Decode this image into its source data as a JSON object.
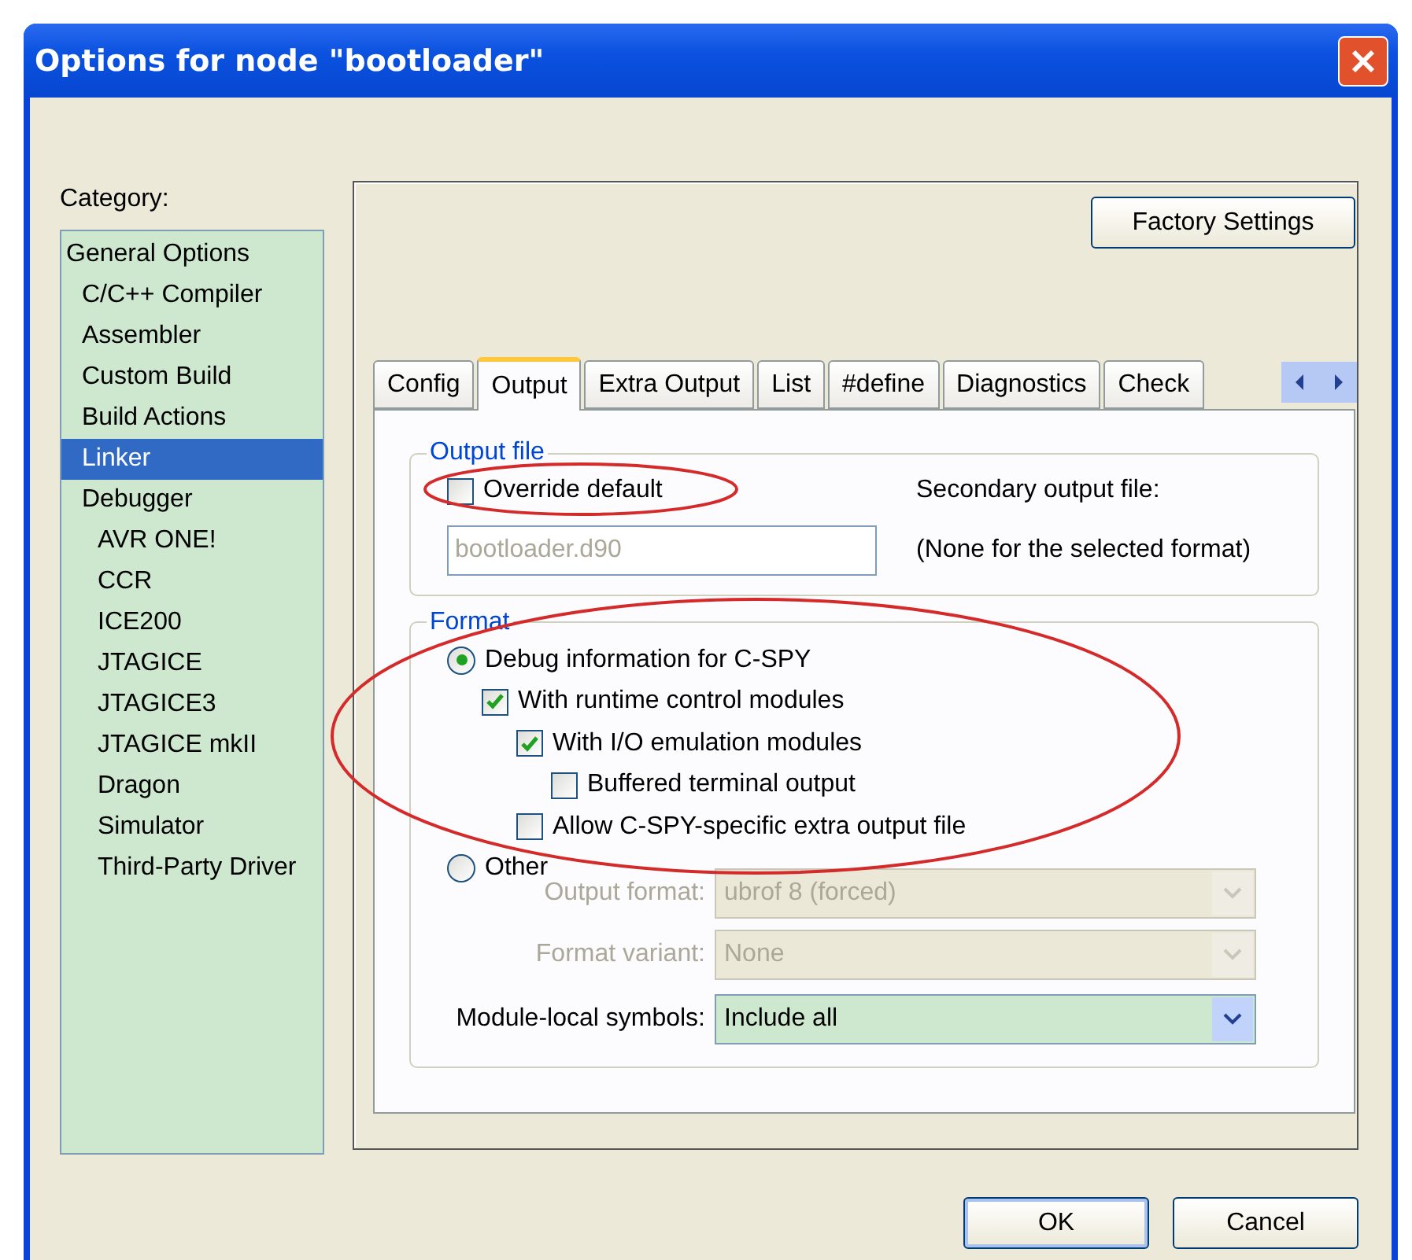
{
  "window": {
    "title": "Options for node \"bootloader\""
  },
  "category": {
    "label": "Category:",
    "items": [
      {
        "label": "General Options",
        "selected": false,
        "children": [
          {
            "label": "C/C++ Compiler",
            "selected": false
          },
          {
            "label": "Assembler",
            "selected": false
          },
          {
            "label": "Custom Build",
            "selected": false
          },
          {
            "label": "Build Actions",
            "selected": false
          },
          {
            "label": "Linker",
            "selected": true
          },
          {
            "label": "Debugger",
            "selected": false,
            "children": [
              {
                "label": "AVR ONE!",
                "selected": false
              },
              {
                "label": "CCR",
                "selected": false
              },
              {
                "label": "ICE200",
                "selected": false
              },
              {
                "label": "JTAGICE",
                "selected": false
              },
              {
                "label": "JTAGICE3",
                "selected": false
              },
              {
                "label": "JTAGICE mkII",
                "selected": false
              },
              {
                "label": "Dragon",
                "selected": false
              },
              {
                "label": "Simulator",
                "selected": false
              },
              {
                "label": "Third-Party Driver",
                "selected": false
              }
            ]
          }
        ]
      }
    ]
  },
  "factory_button": "Factory Settings",
  "tabs": [
    {
      "label": "Config",
      "selected": false
    },
    {
      "label": "Output",
      "selected": true
    },
    {
      "label": "Extra Output",
      "selected": false
    },
    {
      "label": "List",
      "selected": false
    },
    {
      "label": "#define",
      "selected": false
    },
    {
      "label": "Diagnostics",
      "selected": false
    },
    {
      "label": "Check",
      "selected": false
    }
  ],
  "output_file": {
    "legend": "Output file",
    "override": {
      "label": "Override default",
      "checked": false
    },
    "file": {
      "value": "bootloader.d90",
      "disabled": true
    },
    "secondary_label": "Secondary output file:",
    "secondary_value": "(None for the selected format)"
  },
  "format": {
    "legend": "Format",
    "options": [
      {
        "kind": "radio",
        "label": "Debug information for C-SPY",
        "selected": true,
        "children": [
          {
            "kind": "checkbox",
            "label": "With runtime control modules",
            "checked": true,
            "children": [
              {
                "kind": "checkbox",
                "label": "With I/O emulation modules",
                "checked": true,
                "children": [
                  {
                    "kind": "checkbox",
                    "label": "Buffered terminal output",
                    "checked": false
                  }
                ]
              },
              {
                "kind": "checkbox",
                "label": "Allow C-SPY-specific extra output file",
                "checked": false
              }
            ]
          }
        ]
      },
      {
        "kind": "radio",
        "label": "Other",
        "selected": false
      }
    ],
    "selects": [
      {
        "label": "Output format:",
        "value": "ubrof 8 (forced)",
        "disabled": true
      },
      {
        "label": "Format variant:",
        "value": "None",
        "disabled": true
      },
      {
        "label": "Module-local symbols:",
        "value": "Include all",
        "disabled": false
      }
    ]
  },
  "annotations": [
    {
      "kind": "ellipse"
    },
    {
      "kind": "ellipse"
    }
  ],
  "buttons": [
    {
      "label": "OK",
      "default": true
    },
    {
      "label": "Cancel",
      "default": false
    }
  ]
}
